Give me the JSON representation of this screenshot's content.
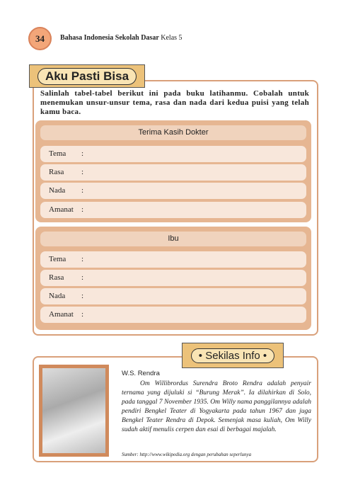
{
  "header": {
    "page_number": "34",
    "book_title_bold": "Bahasa Indonesia Sekolah Dasar",
    "book_title_rest": "Kelas 5"
  },
  "exercise": {
    "label": "Aku Pasti Bisa",
    "instruction": "Salinlah tabel-tabel berikut ini pada buku latihanmu. Cobalah untuk menemukan unsur-unsur tema, rasa dan nada dari kedua puisi yang telah kamu baca.",
    "tables": [
      {
        "title": "Terima Kasih Dokter",
        "rows": [
          {
            "label": "Tema",
            "sep": ":"
          },
          {
            "label": "Rasa",
            "sep": ":"
          },
          {
            "label": "Nada",
            "sep": ":"
          },
          {
            "label": "Amanat",
            "sep": ":"
          }
        ]
      },
      {
        "title": "Ibu",
        "rows": [
          {
            "label": "Tema",
            "sep": ":"
          },
          {
            "label": "Rasa",
            "sep": ":"
          },
          {
            "label": "Nada",
            "sep": ":"
          },
          {
            "label": "Amanat",
            "sep": ":"
          }
        ]
      }
    ]
  },
  "info": {
    "label": "• Sekilas Info •",
    "name": "W.S. Rendra",
    "text": "Om Willibrordus Surendra Broto Rendra adalah penyair ternama yang dijuluki si “Burung Merak”. Ia dilahirkan di Solo, pada tanggal 7 November 1935. Om Willy nama panggilannya adalah pendiri Bengkel Teater di Yogyakarta pada tahun 1967 dan juga Bengkel Teater Rendra di Depok. Semenjak masa kuliah, Om Willy sudah aktif menulis cerpen dan esai di berbagai majalah.",
    "source": "Sumber: http://www.wikipedia.org dengan perubahan seperlunya"
  }
}
